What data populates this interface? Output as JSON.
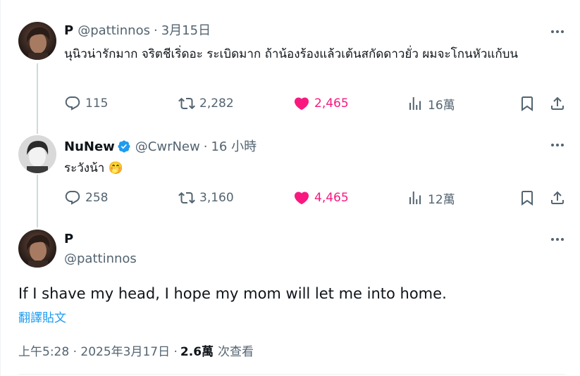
{
  "tweet1": {
    "name": "P",
    "handle": "@pattinnos",
    "separator": "·",
    "time": "3月15日",
    "text": "นุนิวน่ารักมาก จริตชีเริ่ดอะ ระเบิดมาก ถ้าน้องร้องแล้วเต้นสกัดดาวยั่ว ผมจะโกนหัวแก้บน",
    "replies": "115",
    "retweets": "2,282",
    "likes": "2,465",
    "views": "16萬"
  },
  "tweet2": {
    "name": "NuNew",
    "handle": "@CwrNew",
    "separator": "·",
    "time": "16 小時",
    "text": "ระวังน้า",
    "emoji": "🤭",
    "replies": "258",
    "retweets": "3,160",
    "likes": "4,465",
    "views": "12萬"
  },
  "main_tweet": {
    "name": "P",
    "handle": "@pattinnos",
    "text": "If I shave my head, I hope my mom will let me into home.",
    "translate": "翻譯貼文",
    "timestamp": "上午5:28 · 2025年3月17日 ·",
    "views_count": "2.6萬",
    "views_label": "次查看"
  },
  "colors": {
    "like": "#f91880",
    "verified": "#1d9bf0",
    "muted": "#536471",
    "link": "#1d9bf0"
  },
  "icons": [
    "reply-icon",
    "retweet-icon",
    "heart-icon",
    "views-icon",
    "bookmark-icon",
    "share-icon",
    "more-icon",
    "verified-icon"
  ]
}
